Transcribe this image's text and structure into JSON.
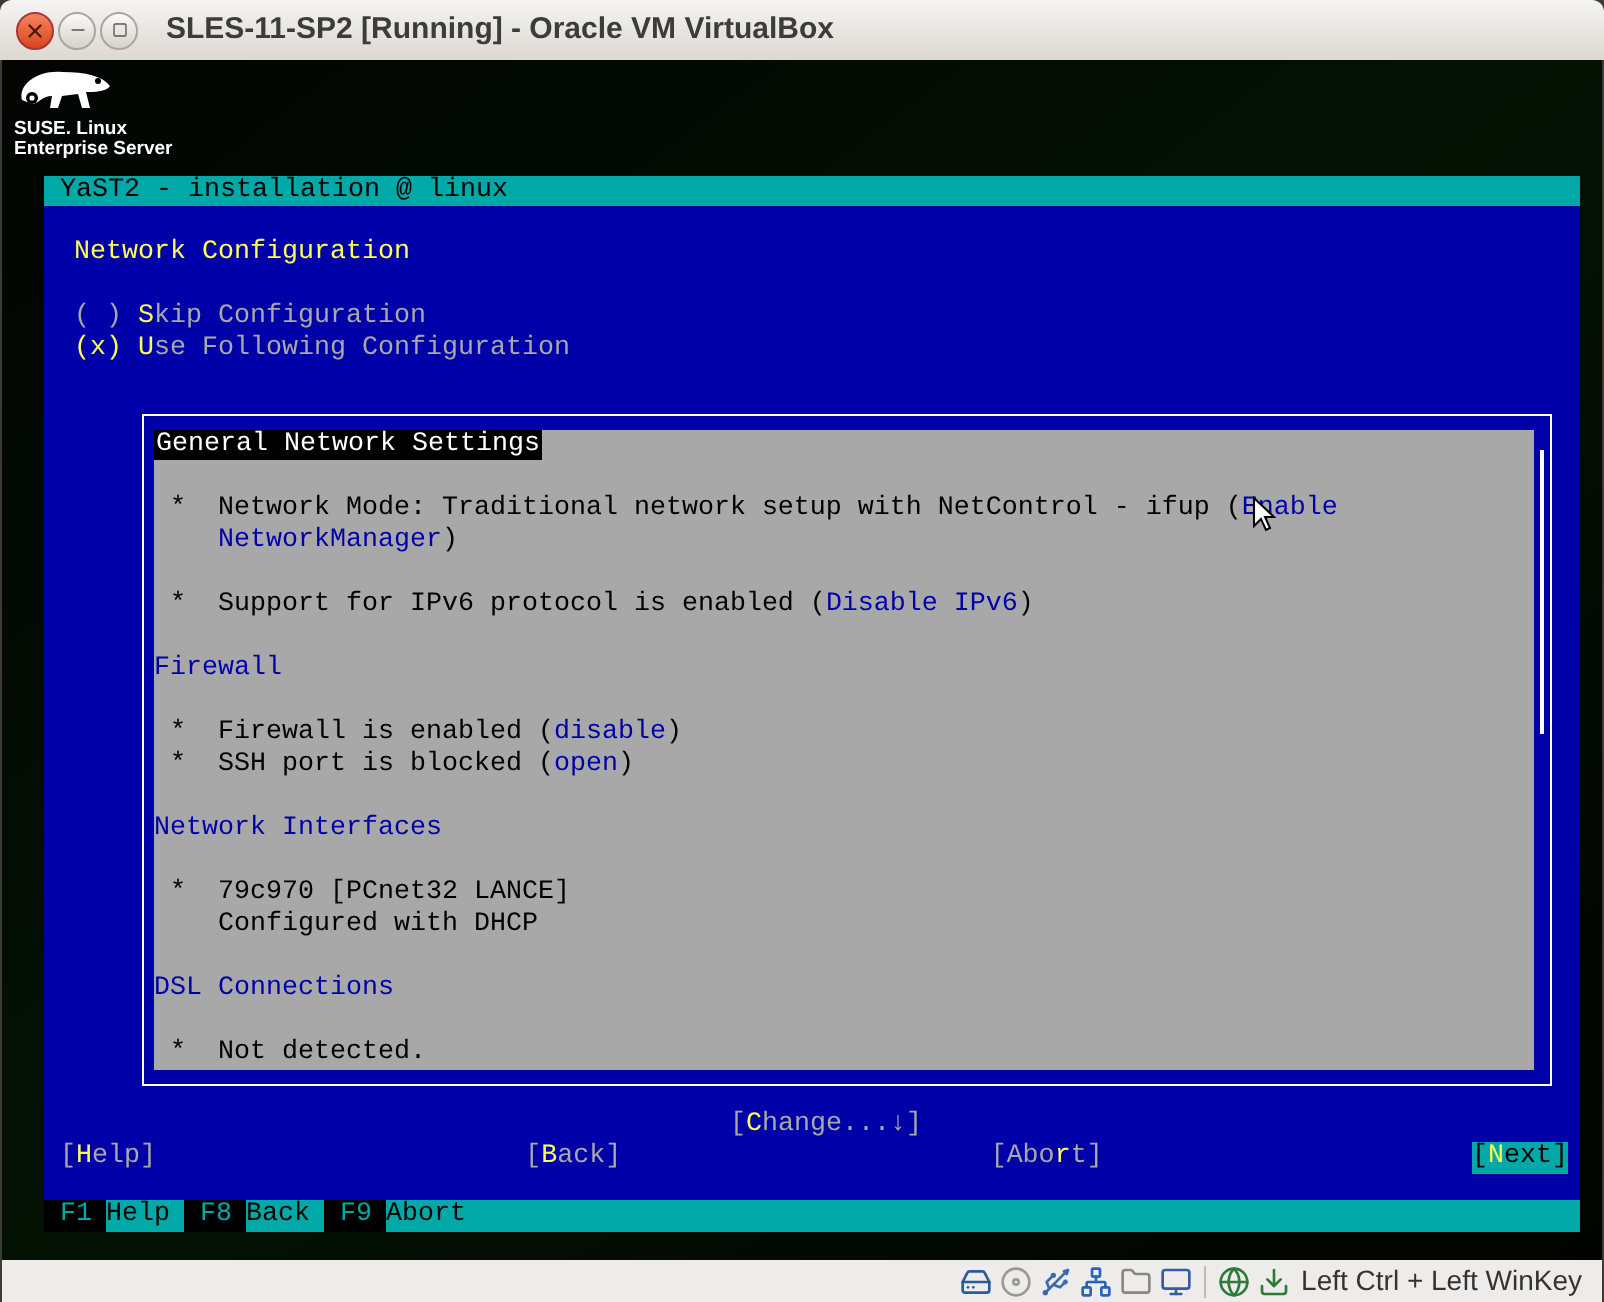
{
  "window": {
    "title": "SLES-11-SP2 [Running] - Oracle VM VirtualBox"
  },
  "logo": {
    "lines": [
      "SUSE. Linux",
      "Enterprise Server"
    ]
  },
  "yast": {
    "title": "YaST2 - installation @ linux",
    "heading": "Network Configuration",
    "radio_marks": [
      "( )",
      "(x)"
    ],
    "options": [
      {
        "key": "S",
        "after": "kip Configuration",
        "selected": false
      },
      {
        "key": "U",
        "after": "se Following Configuration",
        "selected": true
      }
    ],
    "panel": [
      {
        "kind": "title",
        "text": "General Network Settings"
      },
      {
        "kind": "blank"
      },
      {
        "kind": "bullet",
        "mark": "*",
        "lines": [
          [
            {
              "text": "Network Mode: Traditional network setup with NetControl - ifup ("
            },
            {
              "text": "Enable",
              "link": true
            }
          ],
          [
            {
              "text": "NetworkManager",
              "link": true
            },
            {
              "text": ")"
            }
          ]
        ]
      },
      {
        "kind": "blank"
      },
      {
        "kind": "bullet",
        "mark": "*",
        "lines": [
          [
            {
              "text": "Support for IPv6 protocol is enabled ("
            },
            {
              "text": "Disable IPv6",
              "link": true
            },
            {
              "text": ")"
            }
          ]
        ]
      },
      {
        "kind": "blank"
      },
      {
        "kind": "section",
        "text": "Firewall"
      },
      {
        "kind": "blank"
      },
      {
        "kind": "bullet",
        "mark": "*",
        "lines": [
          [
            {
              "text": "Firewall is enabled ("
            },
            {
              "text": "disable",
              "link": true
            },
            {
              "text": ")"
            }
          ]
        ]
      },
      {
        "kind": "bullet",
        "mark": "*",
        "lines": [
          [
            {
              "text": "SSH port is blocked ("
            },
            {
              "text": "open",
              "link": true
            },
            {
              "text": ")"
            }
          ]
        ]
      },
      {
        "kind": "blank"
      },
      {
        "kind": "section",
        "text": "Network Interfaces"
      },
      {
        "kind": "blank"
      },
      {
        "kind": "bullet",
        "mark": "*",
        "lines": [
          [
            {
              "text": "79c970 [PCnet32 LANCE]"
            }
          ],
          [
            {
              "text": "Configured with DHCP"
            }
          ]
        ]
      },
      {
        "kind": "blank"
      },
      {
        "kind": "section",
        "text": "DSL Connections"
      },
      {
        "kind": "blank"
      },
      {
        "kind": "bullet",
        "mark": "*",
        "lines": [
          [
            {
              "text": "Not detected."
            }
          ]
        ]
      }
    ],
    "change_button": {
      "open": "[",
      "key": "C",
      "after": "hange...↓",
      "close": "]"
    },
    "buttons": [
      {
        "open": "[",
        "key": "H",
        "after": "elp",
        "close": "]",
        "selected": false
      },
      {
        "open": "[",
        "key": "B",
        "after": "ack",
        "close": "]",
        "selected": false
      },
      {
        "open": "[",
        "before": "Abo",
        "key": "r",
        "after": "t",
        "close": "]",
        "selected": false
      },
      {
        "open": "[",
        "key": "N",
        "after": "ext",
        "close": "]",
        "selected": true
      }
    ],
    "fkeys": [
      {
        "key": "F1",
        "action": "Help"
      },
      {
        "key": "F8",
        "action": "Back"
      },
      {
        "key": "F9",
        "action": "Abort"
      }
    ]
  },
  "status_bar": {
    "hotkey": "Left Ctrl + Left WinKey"
  }
}
